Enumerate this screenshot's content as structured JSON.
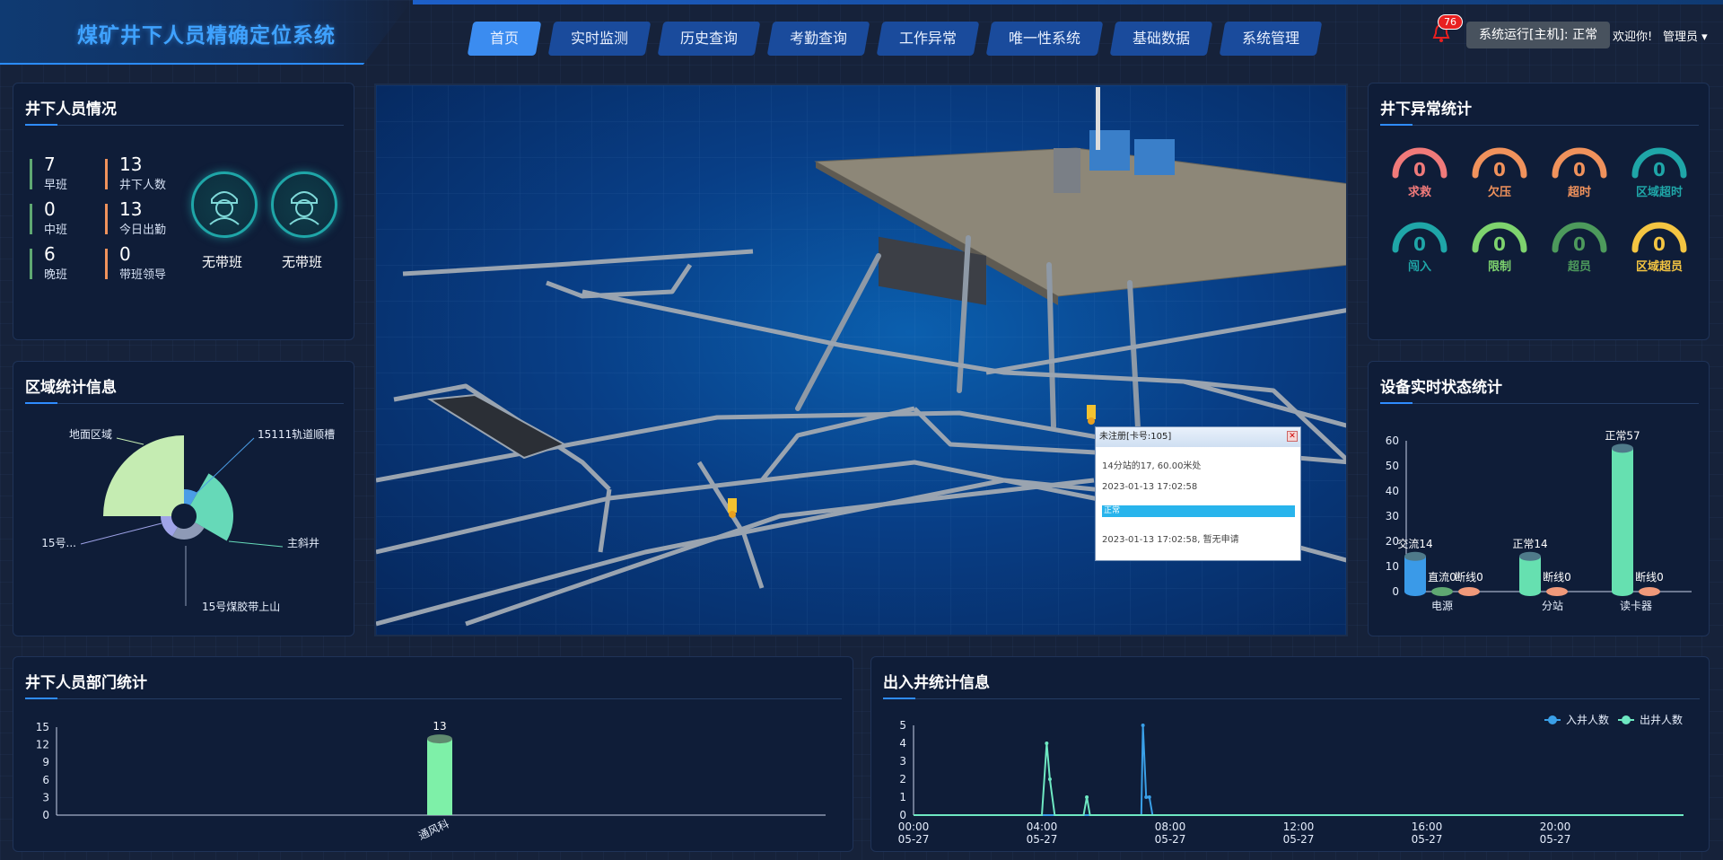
{
  "header": {
    "title": "煤矿井下人员精确定位系统",
    "nav": [
      "首页",
      "实时监测",
      "历史查询",
      "考勤查询",
      "工作异常",
      "唯一性系统",
      "基础数据",
      "系统管理"
    ],
    "active_nav": "首页",
    "alert_count": "76",
    "system_status": "系统运行[主机]: 正常",
    "welcome": "欢迎你!",
    "user": "管理员"
  },
  "staff": {
    "title": "井下人员情况",
    "shifts": [
      {
        "value": "7",
        "label": "早班"
      },
      {
        "value": "0",
        "label": "中班"
      },
      {
        "value": "6",
        "label": "晚班"
      }
    ],
    "totals": [
      {
        "value": "13",
        "label": "井下人数"
      },
      {
        "value": "13",
        "label": "今日出勤"
      },
      {
        "value": "0",
        "label": "带班领导"
      }
    ],
    "leaders": [
      "无带班",
      "无带班"
    ]
  },
  "area": {
    "title": "区域统计信息",
    "chart_data": {
      "type": "pie",
      "labels": [
        "地面区域",
        "15111轨道顺槽",
        "主斜井",
        "15号煤胶带上山",
        "15号..."
      ],
      "colors": [
        "#c5ecb2",
        "#4b9de6",
        "#66d9b8",
        "#8e9ab6",
        "#9fa3e8"
      ]
    }
  },
  "anomaly": {
    "title": "井下异常统计",
    "items": [
      {
        "label": "求救",
        "value": "0",
        "color": "#f07a7a"
      },
      {
        "label": "欠压",
        "value": "0",
        "color": "#f0925c"
      },
      {
        "label": "超时",
        "value": "0",
        "color": "#f0925c"
      },
      {
        "label": "区域超时",
        "value": "0",
        "color": "#1fa6a8"
      },
      {
        "label": "闯入",
        "value": "0",
        "color": "#1fa6a8"
      },
      {
        "label": "限制",
        "value": "0",
        "color": "#7ed36e"
      },
      {
        "label": "超员",
        "value": "0",
        "color": "#4d9a5c"
      },
      {
        "label": "区域超员",
        "value": "0",
        "color": "#f4c542"
      }
    ]
  },
  "device": {
    "title": "设备实时状态统计",
    "chart_data": {
      "type": "bar",
      "categories": [
        "电源",
        "分站",
        "读卡器"
      ],
      "yticks": [
        0,
        10,
        20,
        30,
        40,
        50,
        60
      ],
      "ylim": [
        0,
        60
      ],
      "bars": [
        {
          "category": "电源",
          "label": "交流14",
          "value": 14,
          "color": "#3a9ae8"
        },
        {
          "category": "电源",
          "label": "直流0",
          "value": 0,
          "color": "#5fa872"
        },
        {
          "category": "电源",
          "label": "断线0",
          "value": 0,
          "color": "#f0997a"
        },
        {
          "category": "分站",
          "label": "正常14",
          "value": 14,
          "color": "#66e0b0"
        },
        {
          "category": "分站",
          "label": "断线0",
          "value": 0,
          "color": "#f0997a"
        },
        {
          "category": "读卡器",
          "label": "正常57",
          "value": 57,
          "color": "#66e0b0"
        },
        {
          "category": "读卡器",
          "label": "断线0",
          "value": 0,
          "color": "#f0997a"
        }
      ]
    }
  },
  "dept": {
    "title": "井下人员部门统计",
    "chart_data": {
      "type": "bar",
      "categories": [
        "通风科"
      ],
      "values": [
        13
      ],
      "yticks": [
        0,
        3,
        6,
        9,
        12,
        15
      ],
      "ylim": [
        0,
        15
      ],
      "color": "#7ef0a8"
    }
  },
  "inout": {
    "title": "出入井统计信息",
    "chart_data": {
      "type": "line",
      "xticks": [
        {
          "time": "00:00",
          "date": "05-27"
        },
        {
          "time": "04:00",
          "date": "05-27"
        },
        {
          "time": "08:00",
          "date": "05-27"
        },
        {
          "time": "12:00",
          "date": "05-27"
        },
        {
          "time": "16:00",
          "date": "05-27"
        },
        {
          "time": "20:00",
          "date": "05-27"
        }
      ],
      "yticks": [
        0,
        1,
        2,
        3,
        4,
        5
      ],
      "ylim": [
        0,
        5
      ],
      "xlim_hours": [
        0,
        24
      ],
      "series": [
        {
          "name": "入井人数",
          "color": "#3aa0e8",
          "points": [
            [
              0,
              0
            ],
            [
              6.7,
              0
            ],
            [
              7.1,
              0
            ],
            [
              7.15,
              5
            ],
            [
              7.25,
              1
            ],
            [
              7.35,
              1
            ],
            [
              7.45,
              0
            ],
            [
              24,
              0
            ]
          ]
        },
        {
          "name": "出井人数",
          "color": "#6ee8c2",
          "points": [
            [
              0,
              0
            ],
            [
              4.0,
              0
            ],
            [
              4.15,
              4
            ],
            [
              4.25,
              2
            ],
            [
              4.4,
              0
            ],
            [
              5.3,
              0
            ],
            [
              5.4,
              1
            ],
            [
              5.5,
              0
            ],
            [
              24,
              0
            ]
          ]
        }
      ]
    }
  },
  "popup": {
    "title": "未注册[卡号:105]",
    "position": "14分站的17, 60.00米处",
    "time1": "2023-01-13 17:02:58",
    "status": "正常",
    "note": "2023-01-13 17:02:58, 暂无申请"
  }
}
